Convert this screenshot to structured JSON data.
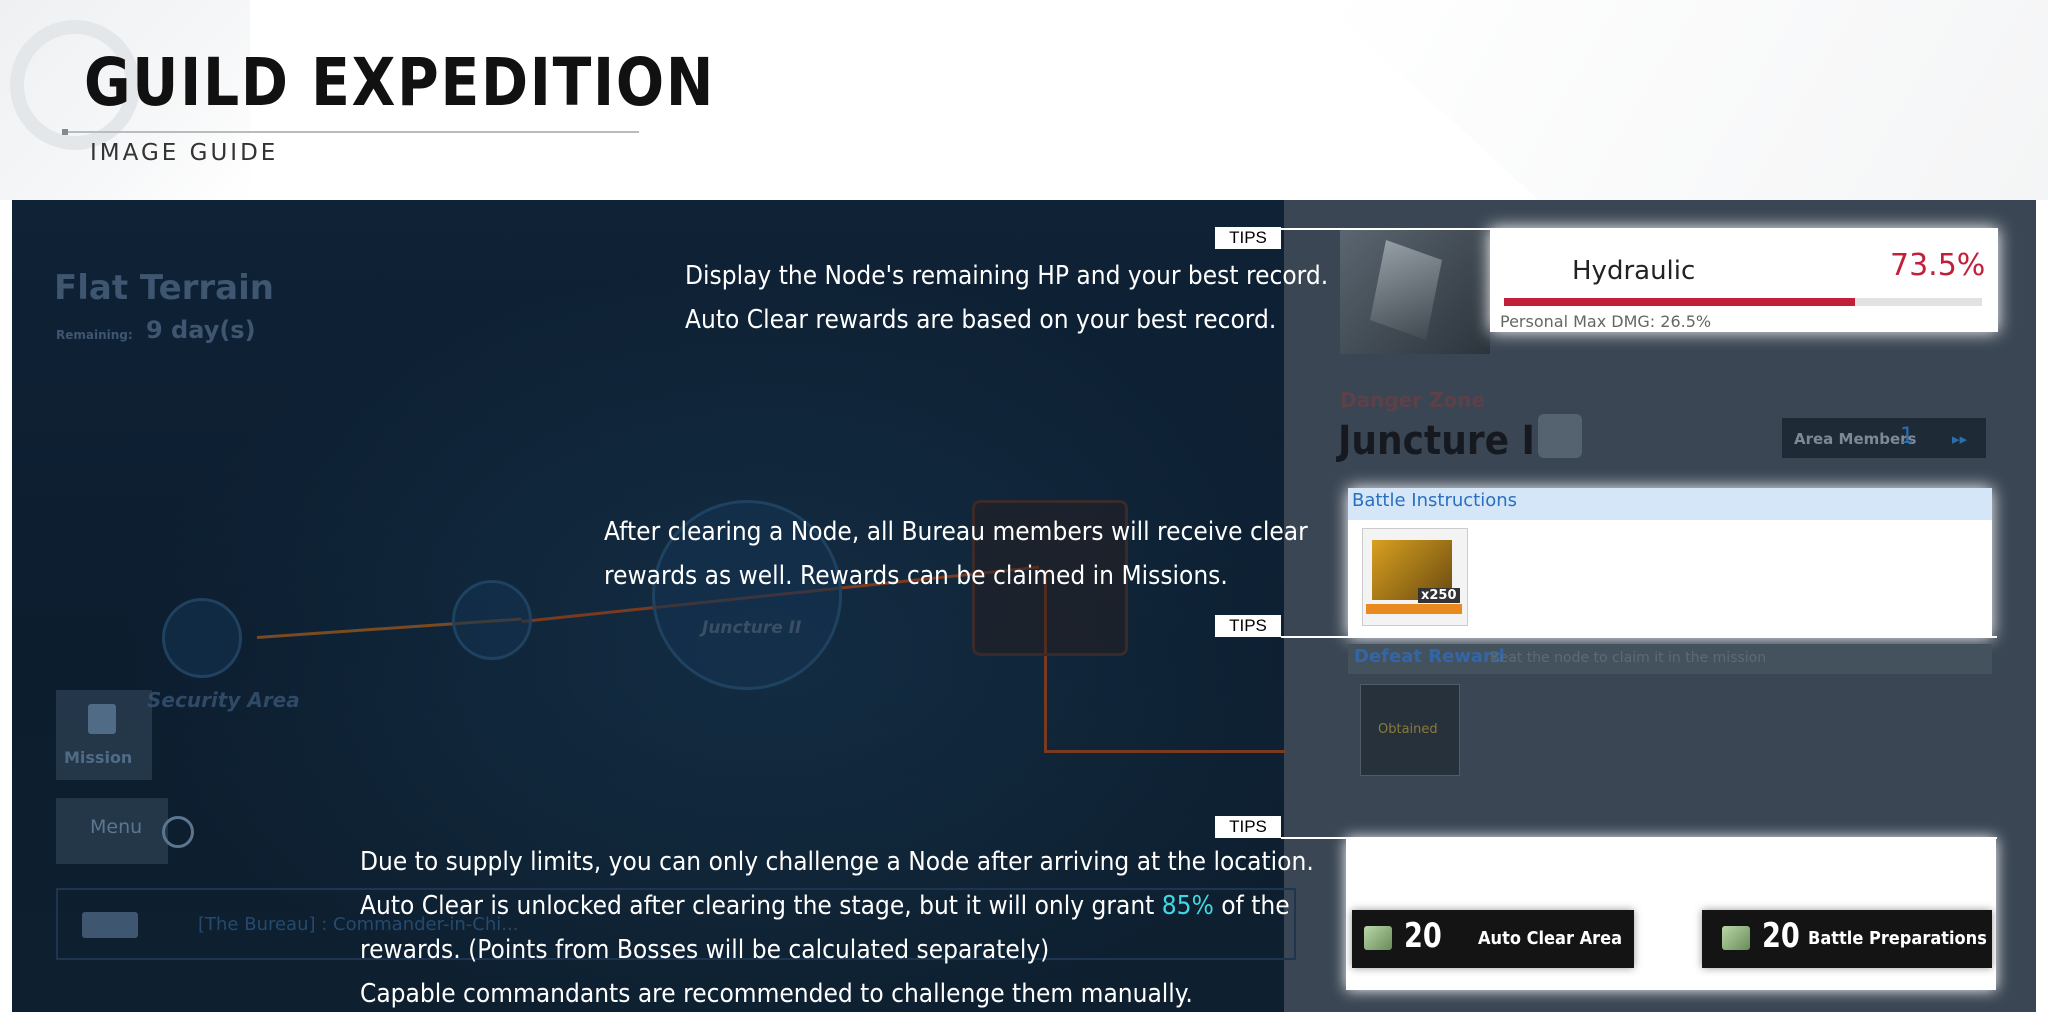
{
  "header": {
    "title": "GUILD EXPEDITION",
    "subtitle": "IMAGE GUIDE"
  },
  "game": {
    "terrain": "Flat Terrain",
    "remaining_label": "Remaining:",
    "remaining_value": "9 day(s)",
    "map_node_label": "Juncture II",
    "area_label": "Security Area",
    "mission_label": "Mission",
    "menu_label": "Menu",
    "chat_text": "[The Bureau] : Commander-in-Chi..."
  },
  "tips": {
    "tag": "TIPS",
    "tip1_line1": "Display the Node's remaining HP and your best record.",
    "tip1_line2": "Auto Clear rewards are based on your best record.",
    "tip2_line1": "After clearing a Node, all Bureau members will receive clear",
    "tip2_line2": "rewards as well. Rewards can be claimed in Missions.",
    "tip3_line1": "Due to supply limits, you can only challenge a Node after arriving at the location.",
    "tip3_line2_pre": "Auto Clear is unlocked after clearing the stage, but it will only grant ",
    "tip3_line2_accent": "85%",
    "tip3_line2_post": " of the",
    "tip3_line3": "rewards. (Points from Bosses will be calculated separately)",
    "tip3_line4": "Capable commandants are recommended to challenge them manually."
  },
  "node_panel": {
    "boss_name": "Hydraulic",
    "hp_percent": "73.5%",
    "hp_fraction": 0.735,
    "personal_max": "Personal Max DMG: 26.5%",
    "danger_zone": "Danger Zone",
    "node_title": "Juncture II",
    "area_members_label": "Area Members",
    "area_members_count": "1",
    "area_arrow": "▸▸",
    "battle_instructions": "Battle Instructions",
    "reward_qty": "x250",
    "defeat_reward": "Defeat Reward",
    "defeat_hint": "Beat the node to claim it in the mission",
    "obtained": "Obtained"
  },
  "actions": {
    "auto_cost": "20",
    "auto_label": "Auto Clear Area",
    "battle_cost": "20",
    "battle_label": "Battle Preparations"
  },
  "colors": {
    "hp_red": "#c0203a",
    "accent_cyan": "#3fd8e6",
    "link_blue": "#2a6fc0"
  }
}
